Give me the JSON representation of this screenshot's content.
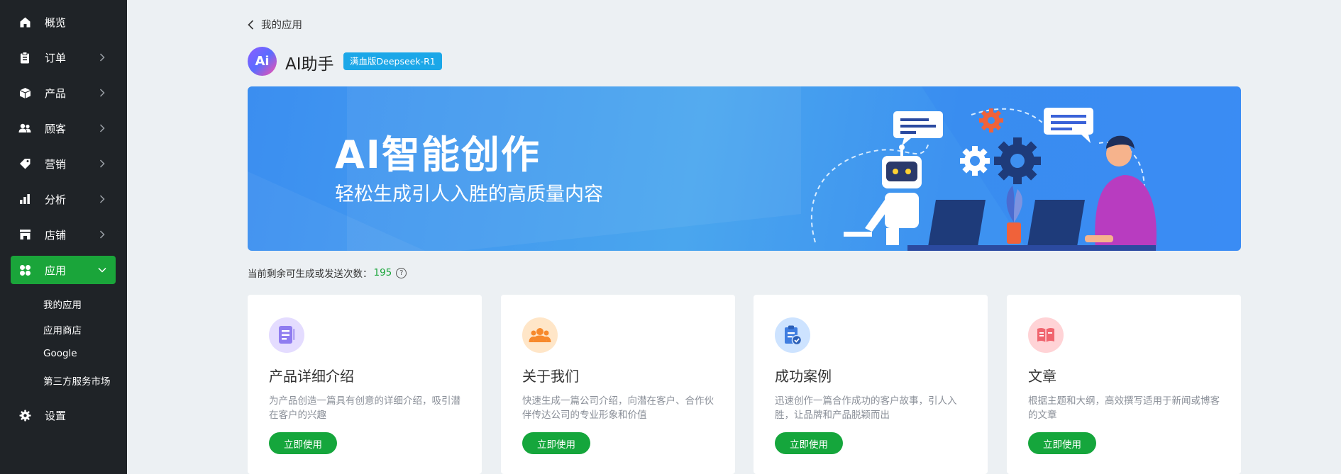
{
  "sidebar": {
    "items": [
      {
        "label": "概览"
      },
      {
        "label": "订单"
      },
      {
        "label": "产品"
      },
      {
        "label": "顾客"
      },
      {
        "label": "营销"
      },
      {
        "label": "分析"
      },
      {
        "label": "店铺"
      },
      {
        "label": "应用"
      },
      {
        "label": "设置"
      }
    ],
    "sub_items": [
      {
        "label": "我的应用"
      },
      {
        "label": "应用商店"
      },
      {
        "label": "Google"
      },
      {
        "label": "第三方服务市场"
      }
    ]
  },
  "header": {
    "back_label": "我的应用",
    "logo_text": "Ai",
    "title": "AI助手",
    "badge": "满血版Deepseek-R1"
  },
  "banner": {
    "title": "AI智能创作",
    "subtitle": "轻松生成引人入胜的高质量内容"
  },
  "quota": {
    "label": "当前剩余可生成或发送次数：",
    "count": "195",
    "help": "?"
  },
  "cards": [
    {
      "title": "产品详细介绍",
      "desc": "为产品创造一篇具有创意的详细介绍，吸引潜在客户的兴趣",
      "button": "立即使用"
    },
    {
      "title": "关于我们",
      "desc": "快速生成一篇公司介绍，向潜在客户、合作伙伴传达公司的专业形象和价值",
      "button": "立即使用"
    },
    {
      "title": "成功案例",
      "desc": "迅速创作一篇合作成功的客户故事，引人入胜，让品牌和产品脱颖而出",
      "button": "立即使用"
    },
    {
      "title": "文章",
      "desc": "根据主题和大纲，高效撰写适用于新闻或博客的文章",
      "button": "立即使用"
    }
  ],
  "colors": {
    "sidebar_bg": "#1f2327",
    "accent_green": "#1aa53a",
    "badge_blue": "#1ba7e8",
    "page_bg": "#ecf0f3"
  }
}
